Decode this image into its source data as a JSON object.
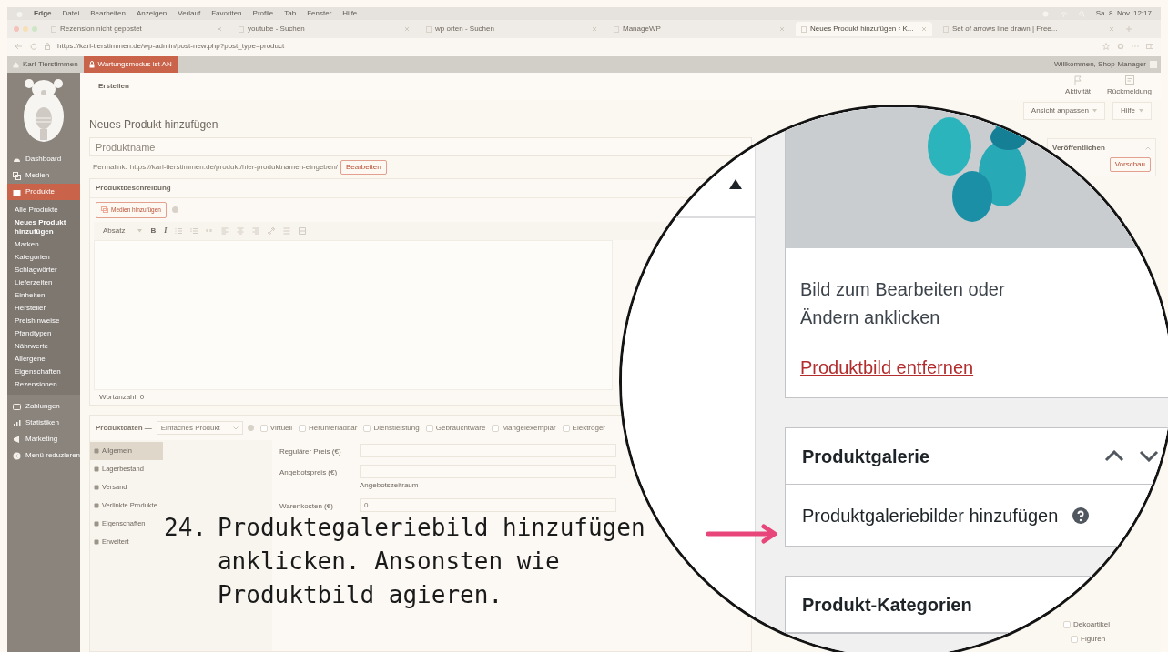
{
  "menubar": {
    "items": [
      "Edge",
      "Datei",
      "Bearbeiten",
      "Anzeigen",
      "Verlauf",
      "Favoriten",
      "Profile",
      "Tab",
      "Fenster",
      "Hilfe"
    ],
    "clock": "Sa. 8. Nov. 12:17"
  },
  "browser_tabs": [
    {
      "label": "Rezension nicht gepostet",
      "selected": false
    },
    {
      "label": "youtube - Suchen",
      "selected": false
    },
    {
      "label": "wp orten - Suchen",
      "selected": false
    },
    {
      "label": "ManageWP",
      "selected": false
    },
    {
      "label": "Neues Produkt hinzufügen ‹ K...",
      "selected": true
    },
    {
      "label": "Set of arrows line drawn | Free...",
      "selected": false
    }
  ],
  "address_bar": {
    "url": "https://karl-tierstimmen.de/wp-admin/post-new.php?post_type=product"
  },
  "admin_bar": {
    "site": "Karl-Tierstimmen",
    "maintenance": "Wartungsmodus ist AN",
    "greeting": "Willkommen, Shop-Manager"
  },
  "sidebar": {
    "items": [
      {
        "label": "Dashboard",
        "selected": false
      },
      {
        "label": "Medien",
        "selected": false
      },
      {
        "label": "Produkte",
        "selected": true,
        "children": [
          {
            "label": "Alle Produkte",
            "selected": false
          },
          {
            "label": "Neues Produkt hinzufügen",
            "selected": true
          },
          {
            "label": "Marken",
            "selected": false
          },
          {
            "label": "Kategorien",
            "selected": false
          },
          {
            "label": "Schlagwörter",
            "selected": false
          },
          {
            "label": "Lieferzeiten",
            "selected": false
          },
          {
            "label": "Einheiten",
            "selected": false
          },
          {
            "label": "Hersteller",
            "selected": false
          },
          {
            "label": "Preishinweise",
            "selected": false
          },
          {
            "label": "Pfandtypen",
            "selected": false
          },
          {
            "label": "Nährwerte",
            "selected": false
          },
          {
            "label": "Allergene",
            "selected": false
          },
          {
            "label": "Eigenschaften",
            "selected": false
          },
          {
            "label": "Rezensionen",
            "selected": false
          }
        ]
      },
      {
        "label": "Zahlungen",
        "selected": false
      },
      {
        "label": "Statistiken",
        "selected": false
      },
      {
        "label": "Marketing",
        "selected": false
      },
      {
        "label": "Menü reduzieren",
        "selected": false
      }
    ]
  },
  "header": {
    "title": "Erstellen",
    "actions": [
      "Aktivität",
      "Rückmeldung"
    ],
    "buttons": [
      "Ansicht anpassen",
      "Hilfe"
    ]
  },
  "editor": {
    "heading": "Neues Produkt hinzufügen",
    "name_placeholder": "Produktname",
    "permalink_label": "Permalink:",
    "permalink": "https://karl-tierstimmen.de/produkt/hier-produktnamen-eingeben/",
    "permalink_button": "Bearbeiten",
    "description_title": "Produktbeschreibung",
    "media_button": "Medien hinzufügen",
    "format": "Absatz",
    "format_buttons": [
      "B",
      "I"
    ],
    "word_count": "Wortanzahl: 0"
  },
  "product_data": {
    "title": "Produktdaten —",
    "type": "Einfaches Produkt",
    "options": [
      {
        "label": "Virtuell",
        "checked": false
      },
      {
        "label": "Herunterladbar",
        "checked": false
      },
      {
        "label": "Dienstleistung",
        "checked": false
      },
      {
        "label": "Gebrauchtware",
        "checked": false
      },
      {
        "label": "Mängelexemplar",
        "checked": false
      },
      {
        "label": "Elektroger",
        "checked": false
      }
    ],
    "tabs": [
      {
        "label": "Allgemein",
        "selected": true
      },
      {
        "label": "Lagerbestand",
        "selected": false
      },
      {
        "label": "Versand",
        "selected": false
      },
      {
        "label": "Verlinkte Produkte",
        "selected": false
      },
      {
        "label": "Eigenschaften",
        "selected": false
      },
      {
        "label": "Erweitert",
        "selected": false
      }
    ],
    "fields": [
      {
        "label": "Regulärer Preis (€)"
      },
      {
        "label": "Angebotspreis (€)",
        "link": "Angebotszeitraum"
      },
      {
        "label": "Warenkosten (€)",
        "placeholder": "0"
      }
    ]
  },
  "publish_box": {
    "title": "Veröffentlichen",
    "button": "Vorschau"
  },
  "categories_list": [
    {
      "label": "Dekoartikel",
      "checked": false,
      "children": [
        {
          "label": "Figuren",
          "checked": false
        }
      ]
    }
  ],
  "magnifier": {
    "image_hint": "Bild zum Bearbeiten oder Ändern anklicken",
    "remove_link": "Produktbild entfernen",
    "gallery": {
      "title": "Produktgalerie",
      "add_link": "Produktgaleriebilder hinzufügen"
    },
    "categories_title": "Produkt-Kategorien"
  },
  "instruction": {
    "number": "24.",
    "text": "Produktegaleriebild hinzufügen anklicken. Ansonsten wie Produktbild agieren."
  }
}
